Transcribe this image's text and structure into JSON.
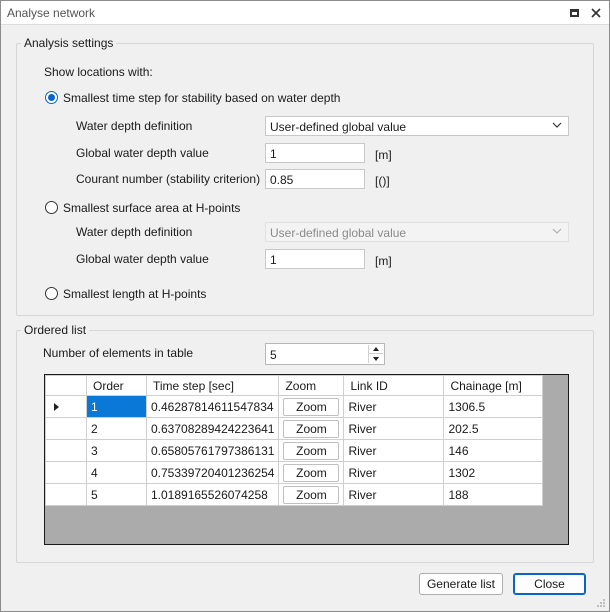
{
  "window": {
    "title": "Analyse network"
  },
  "analysis": {
    "group_title": "Analysis settings",
    "show_label": "Show locations with:",
    "option1": {
      "label": "Smallest time step for stability based on water depth",
      "checked": true,
      "water_depth_def_label": "Water depth definition",
      "water_depth_def_value": "User-defined global value",
      "global_depth_label": "Global water depth value",
      "global_depth_value": "1",
      "global_depth_unit": "[m]",
      "courant_label": "Courant number (stability criterion)",
      "courant_value": "0.85",
      "courant_unit": "[()]"
    },
    "option2": {
      "label": "Smallest surface area at H-points",
      "checked": false,
      "water_depth_def_label": "Water depth definition",
      "water_depth_def_value": "User-defined global value",
      "global_depth_label": "Global water depth value",
      "global_depth_value": "1",
      "global_depth_unit": "[m]"
    },
    "option3": {
      "label": "Smallest length at H-points",
      "checked": false
    }
  },
  "ordered": {
    "group_title": "Ordered list",
    "num_label": "Number of elements in table",
    "num_value": "5",
    "columns": [
      "Order",
      "Time step [sec]",
      "Zoom",
      "Link ID",
      "Chainage [m]"
    ],
    "rows": [
      {
        "order": "1",
        "time_step": "0.46287814611547834",
        "zoom": "Zoom",
        "link_id": "River",
        "chainage": "1306.5"
      },
      {
        "order": "2",
        "time_step": "0.63708289424223641",
        "zoom": "Zoom",
        "link_id": "River",
        "chainage": "202.5"
      },
      {
        "order": "3",
        "time_step": "0.65805761797386131",
        "zoom": "Zoom",
        "link_id": "River",
        "chainage": "146"
      },
      {
        "order": "4",
        "time_step": "0.75339720401236254",
        "zoom": "Zoom",
        "link_id": "River",
        "chainage": "1302"
      },
      {
        "order": "5",
        "time_step": "1.0189165526074258",
        "zoom": "Zoom",
        "link_id": "River",
        "chainage": "188"
      }
    ]
  },
  "buttons": {
    "generate": "Generate list",
    "close": "Close"
  },
  "colors": {
    "accent": "#0a64c8",
    "selection": "#0a78d7",
    "background": "#f0f0f0"
  }
}
